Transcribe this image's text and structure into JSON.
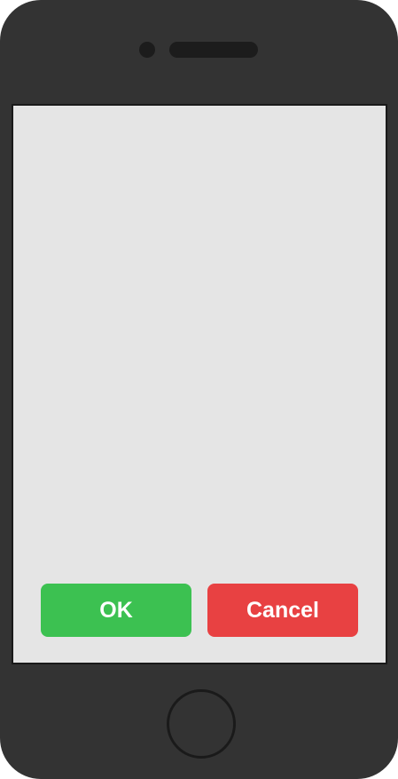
{
  "dialog": {
    "ok_label": "OK",
    "cancel_label": "Cancel"
  },
  "colors": {
    "device_body": "#333333",
    "screen_background": "#e5e5e5",
    "ok_button": "#3cc151",
    "cancel_button": "#e84142",
    "button_text": "#ffffff"
  },
  "icons": {
    "camera": "front-camera-icon",
    "speaker": "earpiece-speaker-icon",
    "home": "home-button"
  }
}
